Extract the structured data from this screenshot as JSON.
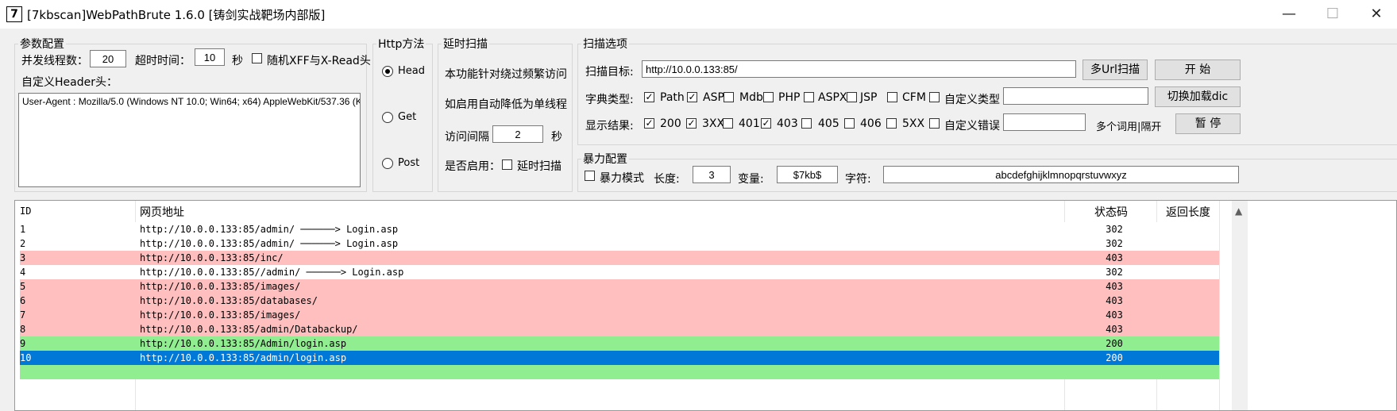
{
  "window": {
    "app_icon": "7",
    "title": "[7kbscan]WebPathBrute 1.6.0 [铸剑实战靶场内部版]",
    "minimize": "—",
    "maximize": "☐",
    "close": "✕"
  },
  "params": {
    "legend": "参数配置",
    "threads_label": "并发线程数：",
    "threads_value": "20",
    "timeout_label": "超时时间：",
    "timeout_value": "10",
    "timeout_unit": "秒",
    "random_xff_label": "随机XFF与X-Read头",
    "random_xff_checked": false,
    "header_label": "自定义Header头：",
    "header_value": "User-Agent : Mozilla/5.0 (Windows NT 10.0; Win64; x64) AppleWebKit/537.36 (K"
  },
  "http_method": {
    "legend": "Http方法",
    "options": [
      "Head",
      "Get",
      "Post"
    ],
    "selected": "Head"
  },
  "delay": {
    "legend": "延时扫描",
    "desc1": "本功能针对绕过频繁访问",
    "desc2": "如启用自动降低为单线程",
    "interval_label": "访问间隔",
    "interval_value": "2",
    "interval_unit": "秒",
    "enable_label": "是否启用：",
    "delay_checkbox_label": "延时扫描",
    "delay_checked": false
  },
  "scan": {
    "legend": "扫描选项",
    "target_label": "扫描目标:",
    "target_value": "http://10.0.0.133:85/",
    "multi_url_button": "多Url扫描",
    "start_button": "开 始",
    "dict_label": "字典类型:",
    "dict_types": [
      {
        "label": "Path",
        "checked": true
      },
      {
        "label": "ASP",
        "checked": true
      },
      {
        "label": "Mdb",
        "checked": false
      },
      {
        "label": "PHP",
        "checked": false
      },
      {
        "label": "ASPX",
        "checked": false
      },
      {
        "label": "JSP",
        "checked": false
      },
      {
        "label": "CFM",
        "checked": false
      },
      {
        "label": "自定义类型",
        "checked": false
      }
    ],
    "custom_type_value": "",
    "switch_dic_button": "切换加载dic",
    "result_label": "显示结果:",
    "result_types": [
      {
        "label": "200",
        "checked": true
      },
      {
        "label": "3XX",
        "checked": true
      },
      {
        "label": "401",
        "checked": false
      },
      {
        "label": "403",
        "checked": true
      },
      {
        "label": "405",
        "checked": false
      },
      {
        "label": "406",
        "checked": false
      },
      {
        "label": "5XX",
        "checked": false
      },
      {
        "label": "自定义错误",
        "checked": false
      }
    ],
    "custom_error_value": "",
    "separator_hint": "多个词用|隔开",
    "pause_button": "暂 停"
  },
  "brute": {
    "legend": "暴力配置",
    "mode_label": "暴力模式",
    "mode_checked": false,
    "length_label": "长度:",
    "length_value": "3",
    "var_label": "变量:",
    "var_value": "$7kb$",
    "chars_label": "字符:",
    "chars_value": "abcdefghijklmnopqrstuvwxyz"
  },
  "table": {
    "headers": {
      "id": "ID",
      "url": "网页地址",
      "status": "状态码",
      "length": "返回长度"
    },
    "rows": [
      {
        "id": "1",
        "url": "http://10.0.0.133:85/admin/  ──────> Login.asp",
        "status": "302",
        "color": "white"
      },
      {
        "id": "2",
        "url": "http://10.0.0.133:85/admin/  ──────> Login.asp",
        "status": "302",
        "color": "white"
      },
      {
        "id": "3",
        "url": "http://10.0.0.133:85/inc/",
        "status": "403",
        "color": "red"
      },
      {
        "id": "4",
        "url": "http://10.0.0.133:85//admin/  ──────> Login.asp",
        "status": "302",
        "color": "white"
      },
      {
        "id": "5",
        "url": "http://10.0.0.133:85/images/",
        "status": "403",
        "color": "red"
      },
      {
        "id": "6",
        "url": "http://10.0.0.133:85/databases/",
        "status": "403",
        "color": "red"
      },
      {
        "id": "7",
        "url": "http://10.0.0.133:85/images/",
        "status": "403",
        "color": "red"
      },
      {
        "id": "8",
        "url": "http://10.0.0.133:85/admin/Databackup/",
        "status": "403",
        "color": "red"
      },
      {
        "id": "9",
        "url": "http://10.0.0.133:85/Admin/login.asp",
        "status": "200",
        "color": "green"
      },
      {
        "id": "10",
        "url": "http://10.0.0.133:85/admin/login.asp",
        "status": "200",
        "color": "sel"
      },
      {
        "id": "",
        "url": "",
        "status": "",
        "color": "green"
      }
    ]
  },
  "colors": {
    "row_403": "#ffbfbf",
    "row_200": "#90ee90",
    "row_selected": "#0078d7"
  }
}
